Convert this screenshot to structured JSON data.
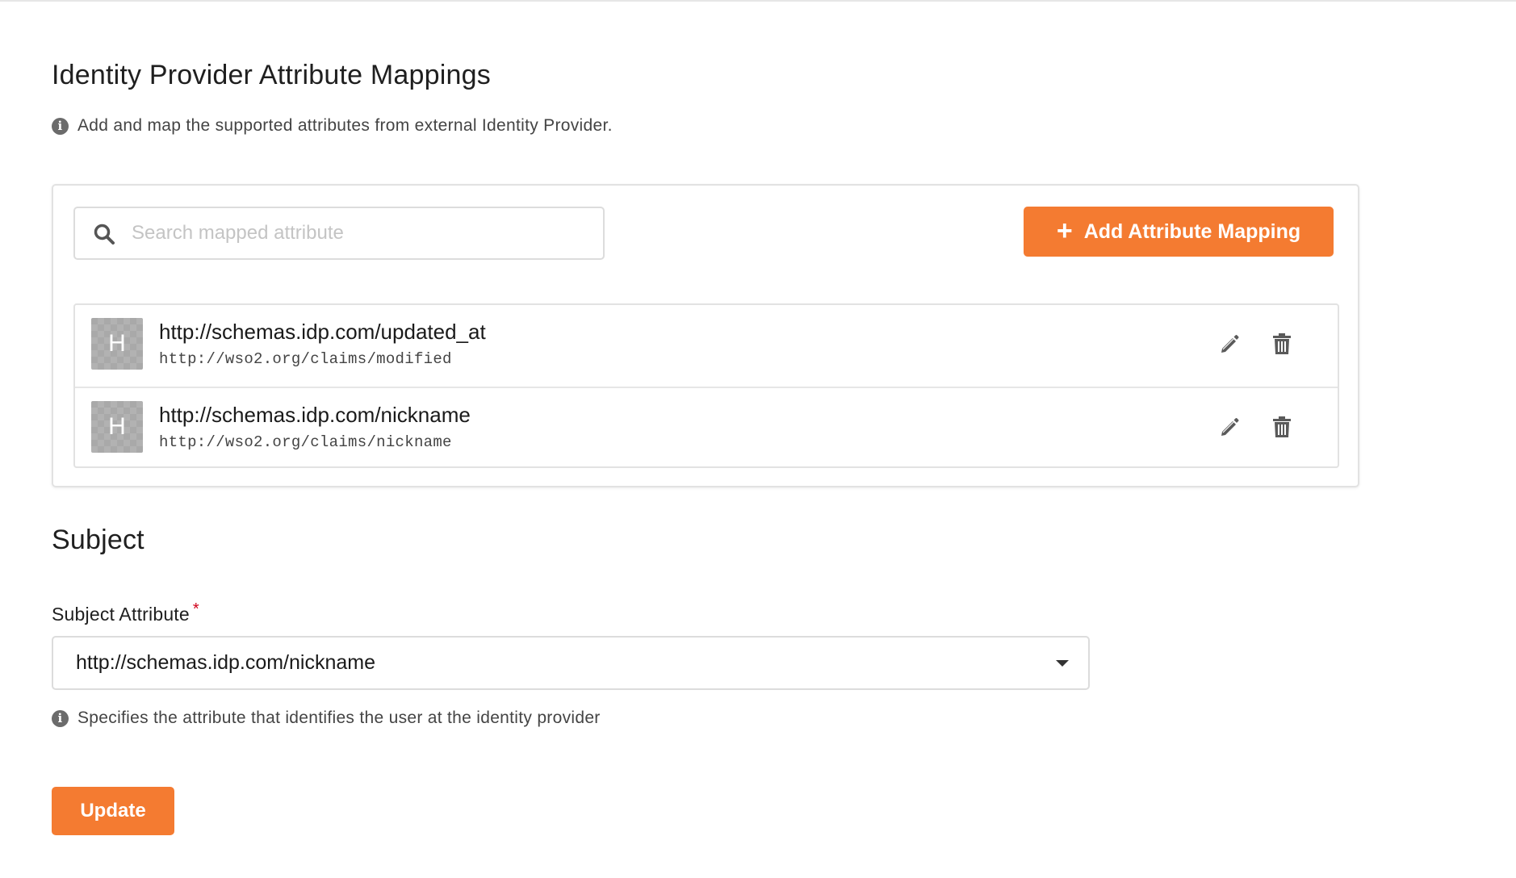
{
  "mappings_section": {
    "title": "Identity Provider Attribute Mappings",
    "hint": "Add and map the supported attributes from external Identity Provider."
  },
  "search": {
    "placeholder": "Search mapped attribute",
    "value": ""
  },
  "add_button": {
    "label": "Add Attribute Mapping"
  },
  "mappings": [
    {
      "avatar_letter": "H",
      "title": "http://schemas.idp.com/updated_at",
      "subtitle": "http://wso2.org/claims/modified"
    },
    {
      "avatar_letter": "H",
      "title": "http://schemas.idp.com/nickname",
      "subtitle": "http://wso2.org/claims/nickname"
    }
  ],
  "subject_section": {
    "title": "Subject",
    "field_label": "Subject Attribute",
    "required_marker": "*",
    "selected_value": "http://schemas.idp.com/nickname",
    "hint": "Specifies the attribute that identifies the user at the identity provider"
  },
  "update_button": {
    "label": "Update"
  },
  "colors": {
    "primary": "#f47b31",
    "required": "#d0021b"
  }
}
